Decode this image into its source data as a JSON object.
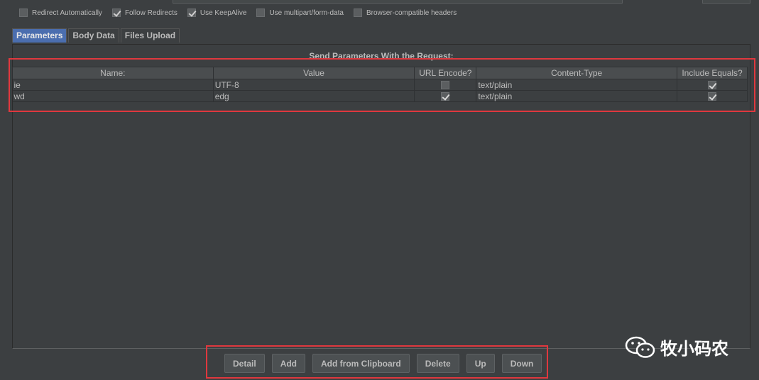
{
  "options": [
    {
      "label": "Redirect Automatically",
      "checked": false
    },
    {
      "label": "Follow Redirects",
      "checked": true
    },
    {
      "label": "Use KeepAlive",
      "checked": true
    },
    {
      "label": "Use multipart/form-data",
      "checked": false
    },
    {
      "label": "Browser-compatible headers",
      "checked": false
    }
  ],
  "tabs": [
    {
      "label": "Parameters",
      "active": true
    },
    {
      "label": "Body Data",
      "active": false
    },
    {
      "label": "Files Upload",
      "active": false
    }
  ],
  "panel": {
    "title": "Send Parameters With the Request:"
  },
  "table": {
    "columns": [
      "Name:",
      "Value",
      "URL Encode?",
      "Content-Type",
      "Include Equals?"
    ],
    "rows": [
      {
        "name": "ie",
        "value": "UTF-8",
        "url_encode": false,
        "content_type": "text/plain",
        "include_equals": true
      },
      {
        "name": "wd",
        "value": "edg",
        "url_encode": true,
        "content_type": "text/plain",
        "include_equals": true
      }
    ]
  },
  "buttons": {
    "detail": "Detail",
    "add": "Add",
    "add_clipboard": "Add from Clipboard",
    "delete": "Delete",
    "up": "Up",
    "down": "Down"
  },
  "watermark": {
    "text": "牧小码农",
    "icon": "wechat-icon"
  },
  "colors": {
    "highlight": "#e0383e",
    "active_tab": "#4b6eaf",
    "background": "#3c3f41"
  }
}
